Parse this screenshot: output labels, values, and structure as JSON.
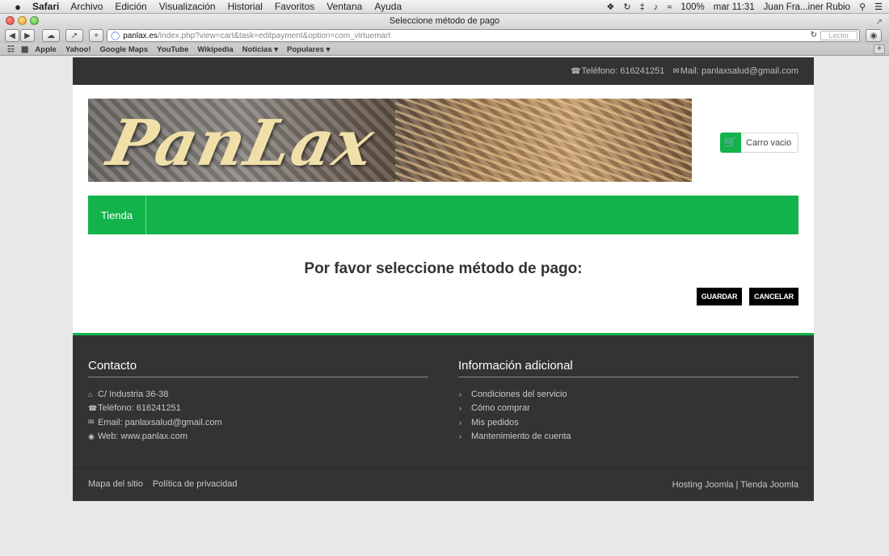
{
  "menubar": {
    "app": "Safari",
    "items": [
      "Archivo",
      "Edición",
      "Visualización",
      "Historial",
      "Favoritos",
      "Ventana",
      "Ayuda"
    ],
    "battery": "100%",
    "clock": "mar 11:31",
    "user": "Juan Fra...iner Rubio"
  },
  "window": {
    "title": "Seleccione método de pago",
    "url_domain": "panlax.es",
    "url_path": "/index.php?view=cart&task=editpayment&option=com_virtuemart",
    "reader_label": "Lector"
  },
  "bookmarks": [
    "Apple",
    "Yahoo!",
    "Google Maps",
    "YouTube",
    "Wikipedia",
    "Noticias ▾",
    "Populares ▾"
  ],
  "topbar": {
    "phone": "Teléfono: 616241251",
    "mail": "Mail: panlaxsalud@gmail.com"
  },
  "header": {
    "logo_text": "PanLax",
    "cart_label": "Carro vacio"
  },
  "nav": {
    "tienda": "Tienda"
  },
  "content": {
    "title": "Por favor seleccione método de pago:",
    "save_label": "GUARDAR",
    "cancel_label": "CANCELAR"
  },
  "footer": {
    "contact_heading": "Contacto",
    "contact": {
      "address": "C/ Industria 36-38",
      "phone": "Teléfono: 616241251",
      "email": "Email: panlaxsalud@gmail.com",
      "web": "Web: www.panlax.com"
    },
    "info_heading": "Información adicional",
    "info_links": [
      "Condiciones del servicio",
      "Cómo comprar",
      "Mis pedidos",
      "Mantenimiento de cuenta"
    ],
    "sitemap": "Mapa del sitio",
    "privacy": "Política de privacidad",
    "hosting": "Hosting Joomla | Tienda Joomla"
  },
  "colors": {
    "brand_green": "#12b34a",
    "dark_bar": "#333333"
  }
}
